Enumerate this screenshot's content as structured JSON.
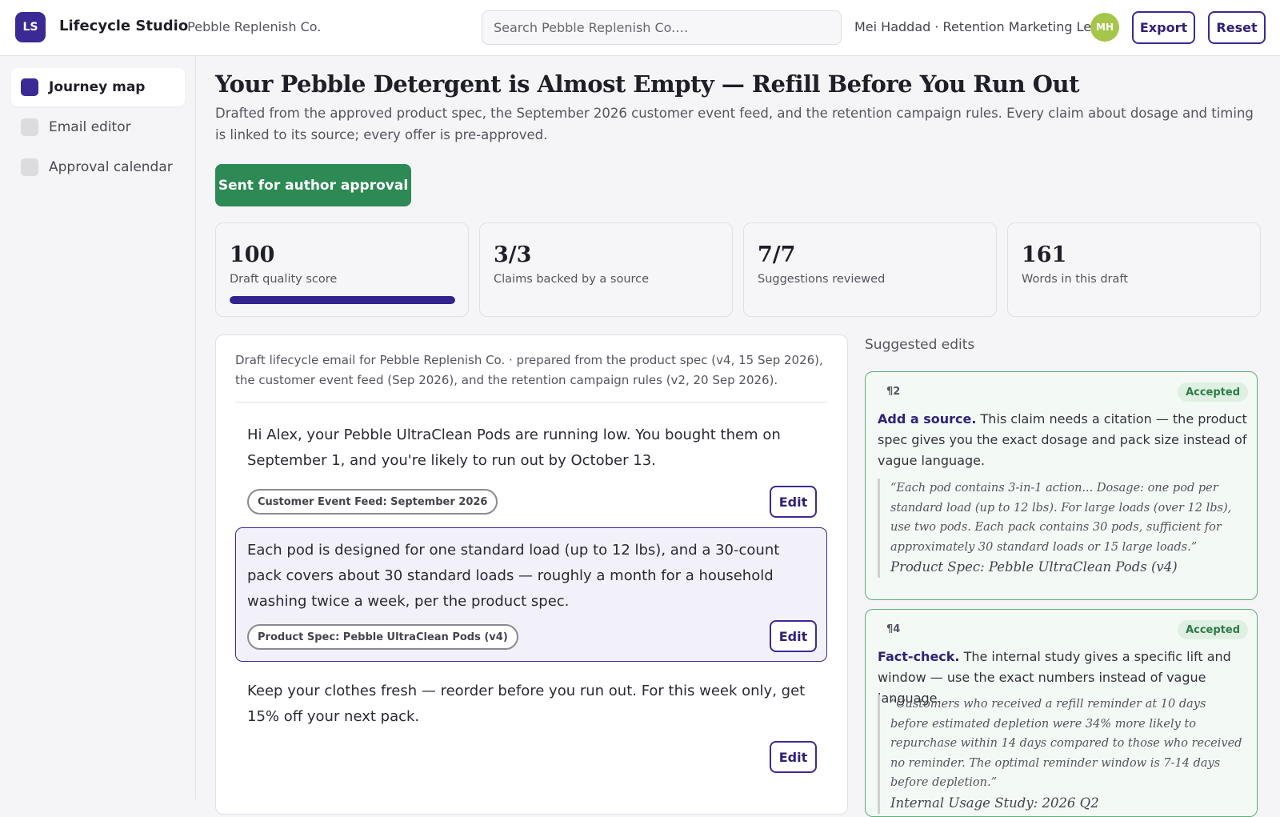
{
  "header": {
    "logo_initials": "LS",
    "app_name": "Lifecycle Studio",
    "org": "· Pebble Replenish Co.",
    "search_placeholder": "Search Pebble Replenish Co.…",
    "user": "Mei Haddad · Retention Marketing Lead",
    "avatar_initials": "MH",
    "export_label": "Export",
    "reset_label": "Reset"
  },
  "sidebar": {
    "items": [
      {
        "label": "Journey map",
        "active": true
      },
      {
        "label": "Email editor",
        "active": false
      },
      {
        "label": "Approval calendar",
        "active": false
      }
    ]
  },
  "main": {
    "title": "Your Pebble Detergent is Almost Empty — Refill Before You Run Out",
    "description": "Drafted from the approved product spec, the September 2026 customer event feed, and the retention campaign rules. Every claim about dosage and timing is linked to its source; every offer is pre-approved.",
    "status_label": "Sent for author approval",
    "stats": [
      {
        "value": "100",
        "label": "Draft quality score",
        "progress": 1.0
      },
      {
        "value": "3/3",
        "label": "Claims backed by a source"
      },
      {
        "value": "7/7",
        "label": "Suggestions reviewed"
      },
      {
        "value": "161",
        "label": "Words in this draft"
      }
    ],
    "draft": {
      "intro": "Draft lifecycle email for Pebble Replenish Co. · prepared from the product spec (v4, 15 Sep 2026), the customer event feed (Sep 2026), and the retention campaign rules (v2, 20 Sep 2026).",
      "edit_label": "Edit",
      "paragraphs": [
        {
          "text": "Hi Alex, your Pebble UltraClean Pods are running low. You bought them on September 1, and you're likely to run out by October 13.",
          "source": "Customer Event Feed: September 2026"
        },
        {
          "text": "Each pod is designed for one standard load (up to 12 lbs), and a 30-count pack covers about 30 standard loads — roughly a month for a household washing twice a week, per the product spec.",
          "source": "Product Spec: Pebble UltraClean Pods (v4)"
        },
        {
          "text": "Keep your clothes fresh — reorder before you run out. For this week only, get 15% off your next pack.",
          "source": ""
        }
      ]
    },
    "suggestions": {
      "heading": "Suggested edits",
      "items": [
        {
          "para": "¶2",
          "status": "Accepted",
          "action": "Add a source.",
          "body": " This claim needs a citation — the product spec gives you the exact dosage and pack size instead of vague language.",
          "quote": "“Each pod contains 3-in-1 action... Dosage: one pod per standard load (up to 12 lbs). For large loads (over 12 lbs), use two pods. Each pack contains 30 pods, sufficient for approximately 30 standard loads or 15 large loads.”",
          "source": "Product Spec: Pebble UltraClean Pods (v4)"
        },
        {
          "para": "¶4",
          "status": "Accepted",
          "action": "Fact-check.",
          "body": " The internal study gives a specific lift and window — use the exact numbers instead of vague language.",
          "quote": "“Customers who received a refill reminder at 10 days before estimated depletion were 34% more likely to repurchase within 14 days compared to those who received no reminder. The optimal reminder window is 7-14 days before depletion.”",
          "source": "Internal Usage Study: 2026 Q2"
        }
      ]
    }
  },
  "colors": {
    "brand": "#3b2a95",
    "success": "#2d8a55",
    "avatar": "#a6c64a"
  }
}
